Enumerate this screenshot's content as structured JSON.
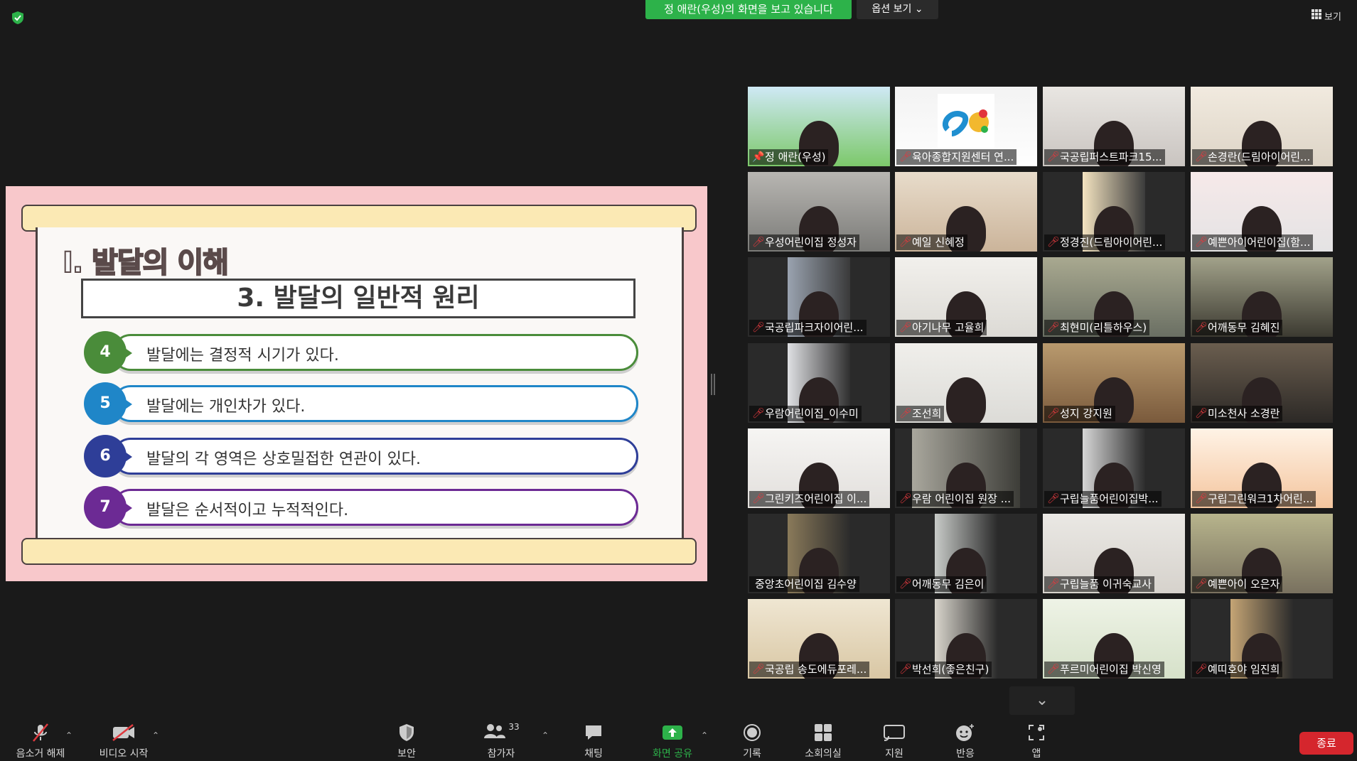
{
  "top": {
    "share_banner": "정 애란(우성)의 화면을 보고 있습니다",
    "view_options": "옵션 보기 ⌄",
    "view_button": "보기"
  },
  "slide": {
    "section_title_prefix": "Ⅰ. ",
    "section_title_pink": "발달",
    "section_title_rest": "의 이해",
    "principle_title": "3. 발달의 일반적 원리",
    "items": [
      {
        "num": "4",
        "text": "발달에는 결정적 시기가 있다.",
        "color": "#4a8c3a"
      },
      {
        "num": "5",
        "text": "발달에는 개인차가 있다.",
        "color": "#1f86c8"
      },
      {
        "num": "6",
        "text": "발달의 각 영역은 상호밀접한 연관이 있다.",
        "color": "#2e3e98"
      },
      {
        "num": "7",
        "text": "발달은 순서적이고 누적적인다.",
        "color": "#6c2a94"
      }
    ]
  },
  "participants": [
    "정 애란(우성)",
    "육아종합지원센터 연...",
    "국공립퍼스트파크15...",
    "손경란(드림아이어린...",
    "우성어린이집 정성자",
    "예일 신혜정",
    "정경진(드림아이어린...",
    "예쁜아이어린이집(함...",
    "국공립파크자이어린...",
    "아기나무 고율희",
    "최현미(리틀하우스)",
    "어깨동무 김혜진",
    "우람어린이집_이수미",
    "조선희",
    "성지 강지원",
    "미소천사 소경란",
    "그린키즈어린이집 이...",
    "우람 어린이집 원장 ...",
    "구립늘품어린이집박...",
    "구립그린워크1차어린...",
    "중앙초어린이집 김수양",
    "어깨동무 김은이",
    "구립늘품 이귀숙교사",
    "예쁜아이 오은자",
    "국공립 송도에듀포레...",
    "박선희(좋은친구)",
    "푸르미어린이집 박신영",
    "예띠호야 임진희"
  ],
  "toolbar": {
    "mute": "음소거 해제",
    "video": "비디오 시작",
    "security": "보안",
    "participants": "참가자",
    "participants_count": "33",
    "chat": "채팅",
    "share": "화면 공유",
    "record": "기록",
    "breakout": "소회의실",
    "remote": "지원",
    "reactions": "반응",
    "apps": "앱",
    "end": "종료"
  }
}
